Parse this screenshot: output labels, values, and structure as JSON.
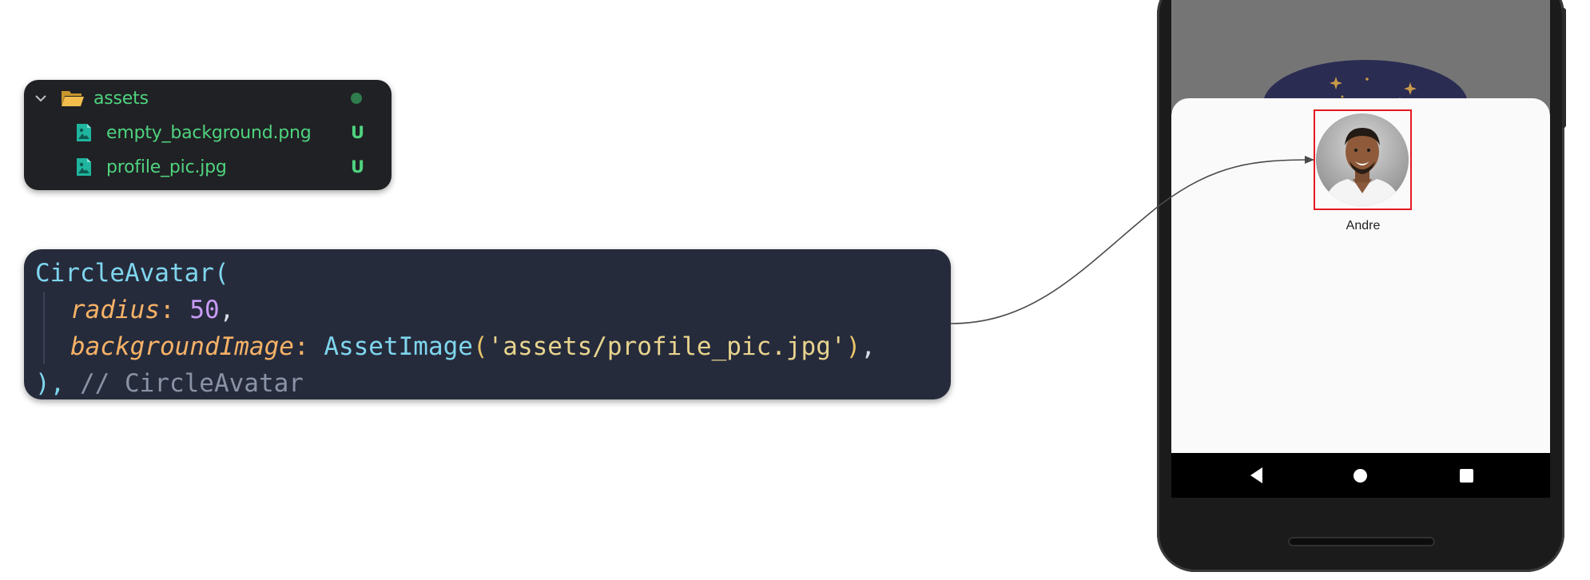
{
  "file_explorer": {
    "folder": {
      "name": "assets",
      "icon": "folder-open-icon",
      "expand_icon": "chevron-down-icon",
      "status": "modified-dot"
    },
    "files": [
      {
        "name": "empty_background.png",
        "icon": "image-file-icon",
        "git_status": "U"
      },
      {
        "name": "profile_pic.jpg",
        "icon": "image-file-icon",
        "git_status": "U"
      }
    ],
    "colors": {
      "text": "#4fd37f",
      "background": "#202124",
      "dot": "#2f7d4c"
    }
  },
  "code": {
    "widget": "CircleAvatar",
    "open_paren": "(",
    "radius_param": "radius",
    "radius_colon": ":",
    "radius_value": "50",
    "radius_comma": ",",
    "bg_param": "backgroundImage",
    "bg_colon": ":",
    "bg_class": "AssetImage",
    "bg_open": "(",
    "bg_path": "'assets/profile_pic.jpg'",
    "bg_close": ")",
    "bg_comma": ",",
    "close": "),",
    "comment": "// CircleAvatar",
    "colors": {
      "background": "#262b3b",
      "class": "#7fd6ee",
      "param": "#f7b267",
      "number": "#c99bf7",
      "string": "#e8d48e",
      "comment": "#8a93a6"
    }
  },
  "phone": {
    "profile": {
      "name": "Andre",
      "avatar_icon": "profile-photo",
      "highlight_color": "#e3191f"
    },
    "navigation": {
      "back_icon": "back-triangle-icon",
      "home_icon": "home-circle-icon",
      "recents_icon": "recents-square-icon"
    },
    "colors": {
      "top": "#757575",
      "sheet": "#fafafa",
      "navbar": "#000000"
    }
  }
}
